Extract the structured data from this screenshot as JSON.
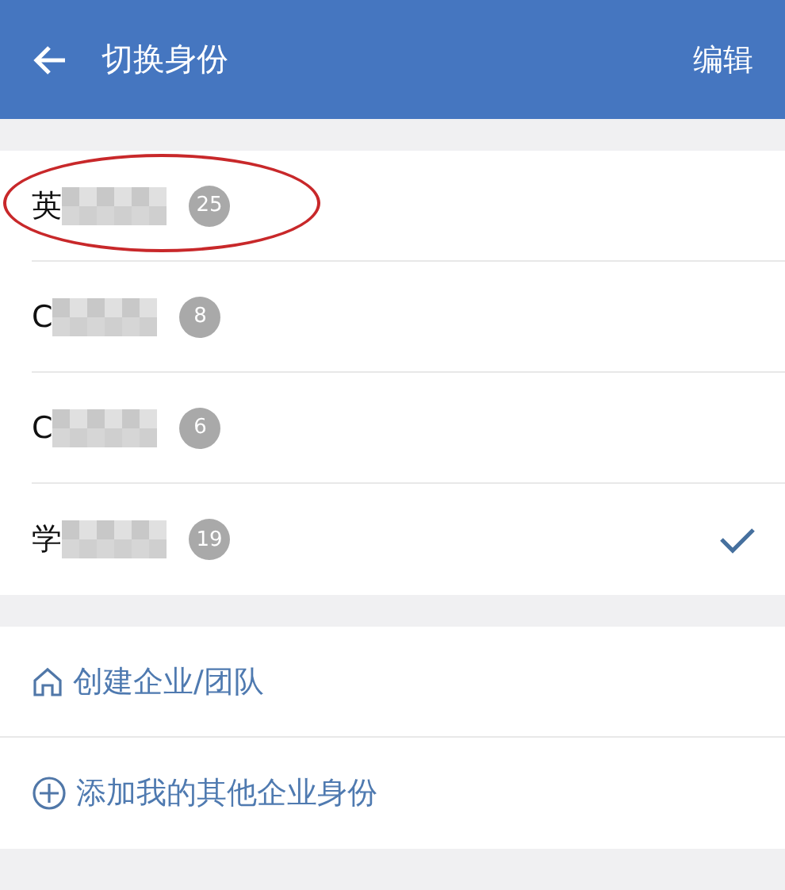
{
  "header": {
    "title": "切换身份",
    "action": "编辑"
  },
  "identities": [
    {
      "name": "英",
      "count": "25",
      "selected": false,
      "circled": true
    },
    {
      "name": "C",
      "count": "8",
      "selected": false,
      "circled": false
    },
    {
      "name": "C",
      "count": "6",
      "selected": false,
      "circled": false
    },
    {
      "name": "学",
      "count": "19",
      "selected": true,
      "circled": false
    }
  ],
  "actions": [
    {
      "kind": "create",
      "label": "创建企业/团队"
    },
    {
      "kind": "add",
      "label": "添加我的其他企业身份"
    }
  ]
}
